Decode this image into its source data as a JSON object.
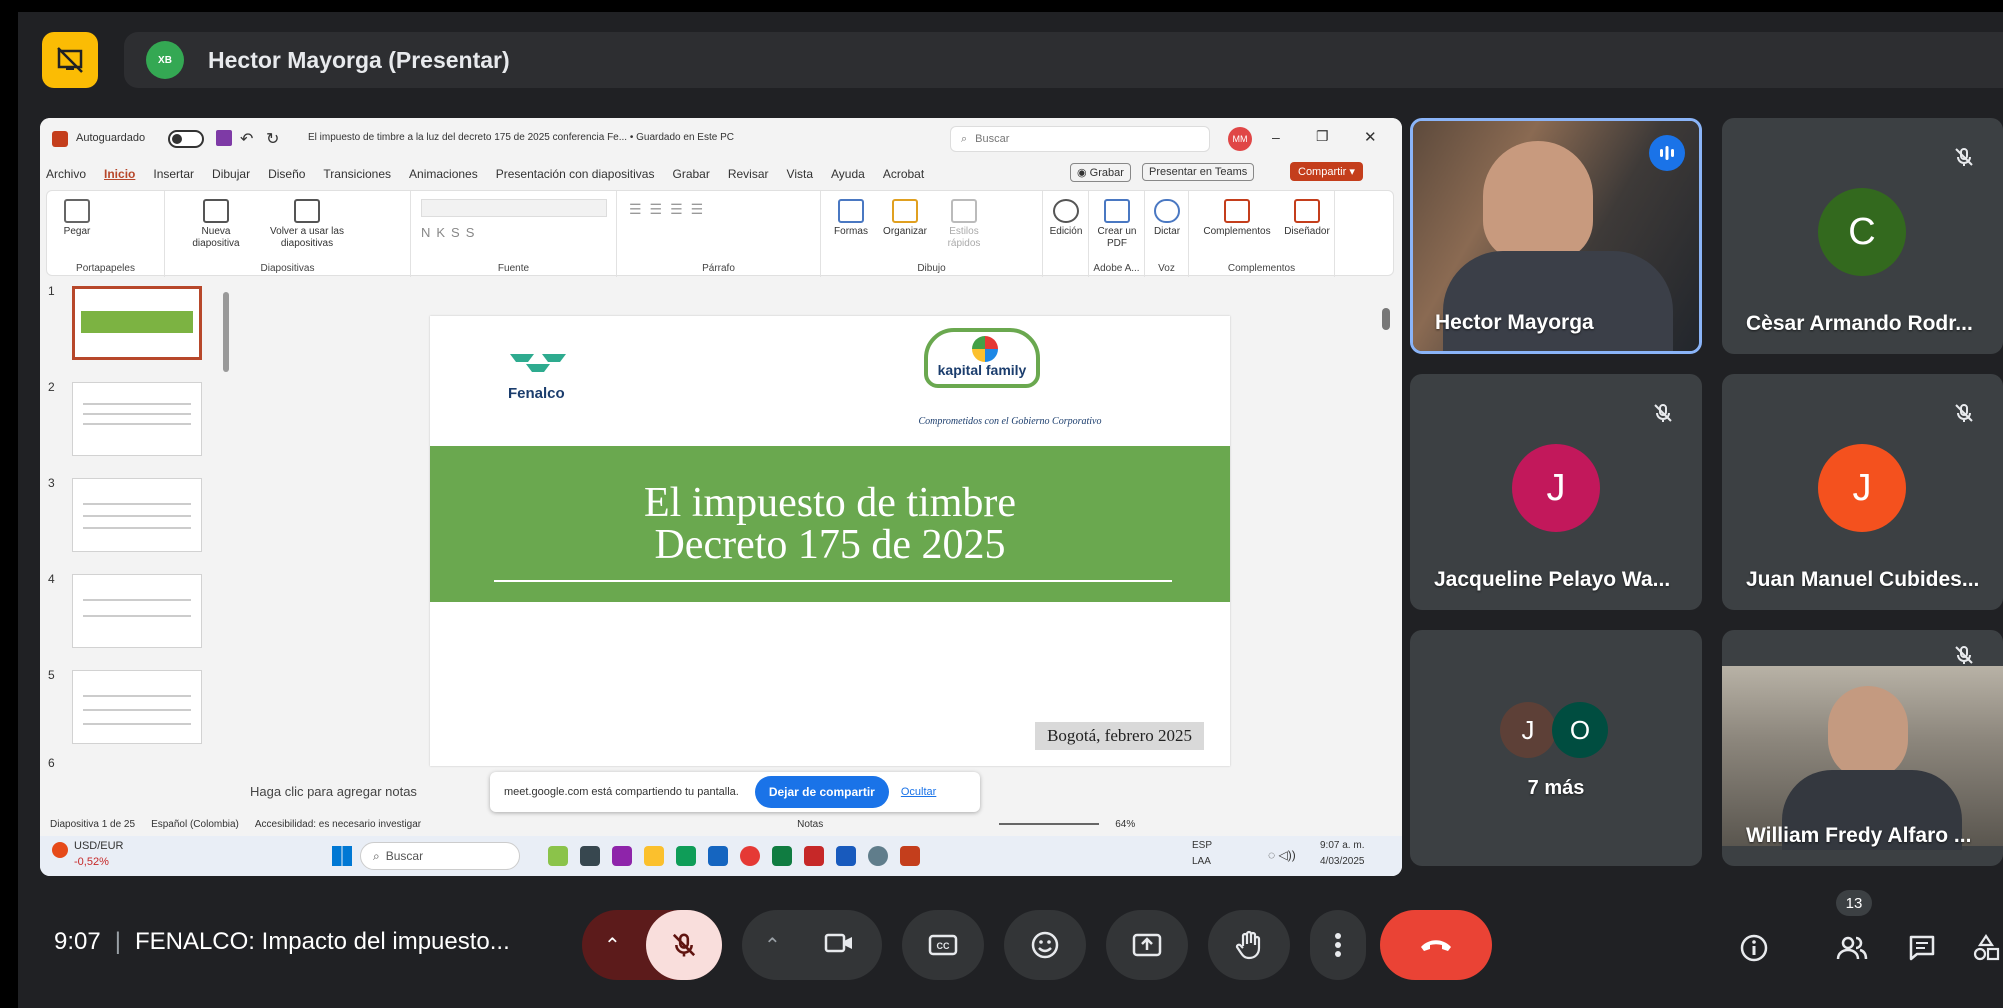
{
  "presenter_bar": {
    "name": "Hector Mayorga (Presentar)",
    "avatar_text": "XB"
  },
  "powerpoint": {
    "autosave_label": "Autoguardado",
    "doc_title": "El impuesto de timbre a la luz del decreto 175 de 2025 conferencia Fe... • Guardado en Este PC",
    "search_placeholder": "Buscar",
    "user_initials": "MM",
    "tabs": [
      "Archivo",
      "Inicio",
      "Insertar",
      "Dibujar",
      "Diseño",
      "Transiciones",
      "Animaciones",
      "Presentación con diapositivas",
      "Grabar",
      "Revisar",
      "Vista",
      "Ayuda",
      "Acrobat"
    ],
    "grabar_btn": "Grabar",
    "teams_btn": "Presentar en Teams",
    "share_btn": "Compartir",
    "ribbon": {
      "pegar": "Pegar",
      "nueva": "Nueva diapositiva",
      "volver": "Volver a usar las diapositivas",
      "formas": "Formas",
      "organizar": "Organizar",
      "estilos": "Estilos rápidos",
      "edicion": "Edición",
      "crear_pdf": "Crear un PDF",
      "dictar": "Dictar",
      "complementos": "Complementos",
      "disenador": "Diseñador",
      "groups": [
        "Portapapeles",
        "Diapositivas",
        "Fuente",
        "Párrafo",
        "Dibujo",
        "Adobe A...",
        "Voz",
        "Complementos"
      ]
    },
    "thumb_numbers": [
      "1",
      "2",
      "3",
      "4",
      "5",
      "6"
    ],
    "slide": {
      "logo_left": "Fenalco",
      "logo_right": "kapital family",
      "tagline": "Comprometidos con el Gobierno Corporativo",
      "title_line1": "El impuesto de timbre",
      "title_line2": "Decreto 175 de 2025",
      "date": "Bogotá, febrero 2025"
    },
    "notes_placeholder": "Haga clic para agregar notas",
    "sharing_bar": {
      "message": "meet.google.com está compartiendo tu pantalla.",
      "stop": "Dejar de compartir",
      "hide": "Ocultar"
    },
    "status": {
      "slide_count": "Diapositiva 1 de 25",
      "language": "Español (Colombia)",
      "accessibility": "Accesibilidad: es necesario investigar",
      "notes": "Notas",
      "zoom": "64%"
    },
    "taskbar": {
      "ticker": "USD/EUR",
      "ticker_change": "-0,52%",
      "search": "Buscar",
      "lang1": "ESP",
      "lang2": "LAA",
      "time": "9:07 a. m.",
      "date": "4/03/2025"
    }
  },
  "participants": [
    {
      "name": "Hector Mayorga",
      "kind": "video",
      "speaking": true
    },
    {
      "name": "Cèsar Armando Rodr...",
      "initial": "C",
      "color": "#33691e",
      "muted": true
    },
    {
      "name": "Jacqueline Pelayo Wa...",
      "initial": "J",
      "color": "#c2185b",
      "muted": true
    },
    {
      "name": "Juan Manuel Cubides...",
      "initial": "J",
      "color": "#f4511e",
      "muted": true
    },
    {
      "name": "7 más",
      "initials": [
        "J",
        "O"
      ],
      "colors": [
        "#5d4037",
        "#004d40"
      ]
    },
    {
      "name": "William Fredy Alfaro ...",
      "kind": "video",
      "muted": true
    }
  ],
  "bottom": {
    "time": "9:07",
    "meeting_title": "FENALCO: Impacto del impuesto...",
    "participant_count": "13"
  },
  "colors": {
    "meet_bg": "#202124",
    "hangup": "#ea4335",
    "mic_off_bg": "#f9dedc",
    "accent": "#8ab4f8",
    "slide_green": "#6aa84f"
  },
  "icons": [
    "present-off-icon",
    "mic-off-icon",
    "camera-icon",
    "captions-icon",
    "emoji-icon",
    "present-icon",
    "raise-hand-icon",
    "more-vert-icon",
    "hangup-icon",
    "info-icon",
    "people-icon",
    "chat-icon",
    "activities-icon"
  ]
}
